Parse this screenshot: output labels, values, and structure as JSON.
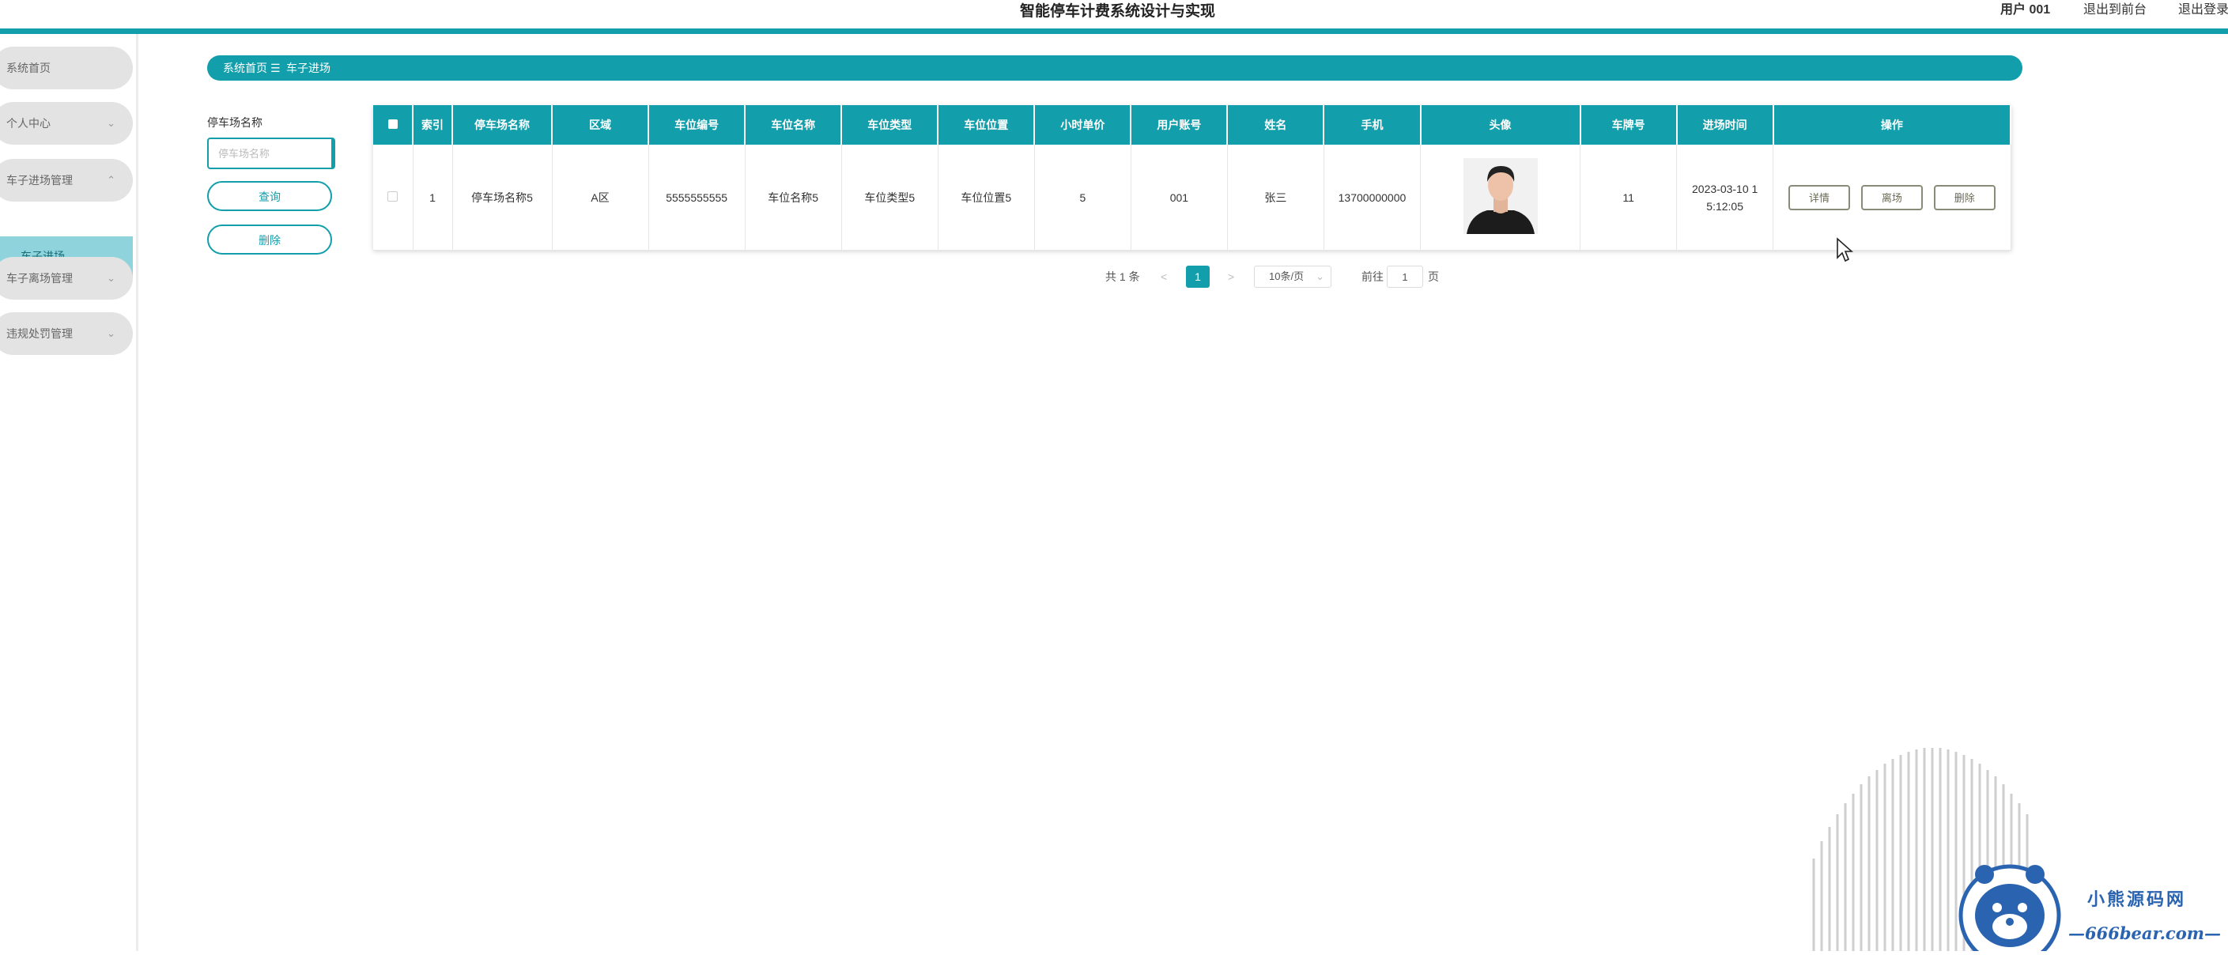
{
  "header": {
    "title": "智能停车计费系统设计与实现",
    "user": "用户 001",
    "back_to_front": "退出到前台",
    "logout": "退出登录"
  },
  "sidebar": {
    "items": [
      {
        "label": "系统首页",
        "chevron": ""
      },
      {
        "label": "个人中心",
        "chevron": "⌄"
      },
      {
        "label": "车子进场管理",
        "chevron": "⌃"
      },
      {
        "label": "车子离场管理",
        "chevron": "⌄"
      },
      {
        "label": "违规处罚管理",
        "chevron": "⌄"
      }
    ],
    "active_sub": "车子进场"
  },
  "breadcrumb": {
    "home": "系统首页",
    "separator": "☰",
    "current": "车子进场"
  },
  "search": {
    "label": "停车场名称",
    "placeholder": "停车场名称",
    "query_button": "查询",
    "delete_button": "删除"
  },
  "table": {
    "columns": [
      "索引",
      "停车场名称",
      "区域",
      "车位编号",
      "车位名称",
      "车位类型",
      "车位位置",
      "小时单价",
      "用户账号",
      "姓名",
      "手机",
      "头像",
      "车牌号",
      "进场时间",
      "操作"
    ],
    "rows": [
      {
        "index": "1",
        "parking_name": "停车场名称5",
        "area": "A区",
        "space_no": "5555555555",
        "space_name": "车位名称5",
        "space_type": "车位类型5",
        "space_location": "车位位置5",
        "hourly_price": "5",
        "user_account": "001",
        "name": "张三",
        "phone": "13700000000",
        "plate": "11",
        "entry_time_line1": "2023-03-10 1",
        "entry_time_line2": "5:12:05",
        "actions": [
          "详情",
          "离场",
          "删除"
        ]
      }
    ]
  },
  "pagination": {
    "total": "共 1 条",
    "prev": "<",
    "current_page": "1",
    "next": ">",
    "page_size": "10条/页",
    "goto_prefix": "前往",
    "goto_value": "1",
    "goto_suffix": "页"
  },
  "watermark": {
    "brand": "小熊源码网",
    "url": "—666bear.com—"
  },
  "colors": {
    "accent": "#129fab",
    "sidebar_item_bg": "#e3e3e3",
    "active_sub_bg": "#8fd4dd",
    "watermark_blue": "#2a63b0"
  }
}
